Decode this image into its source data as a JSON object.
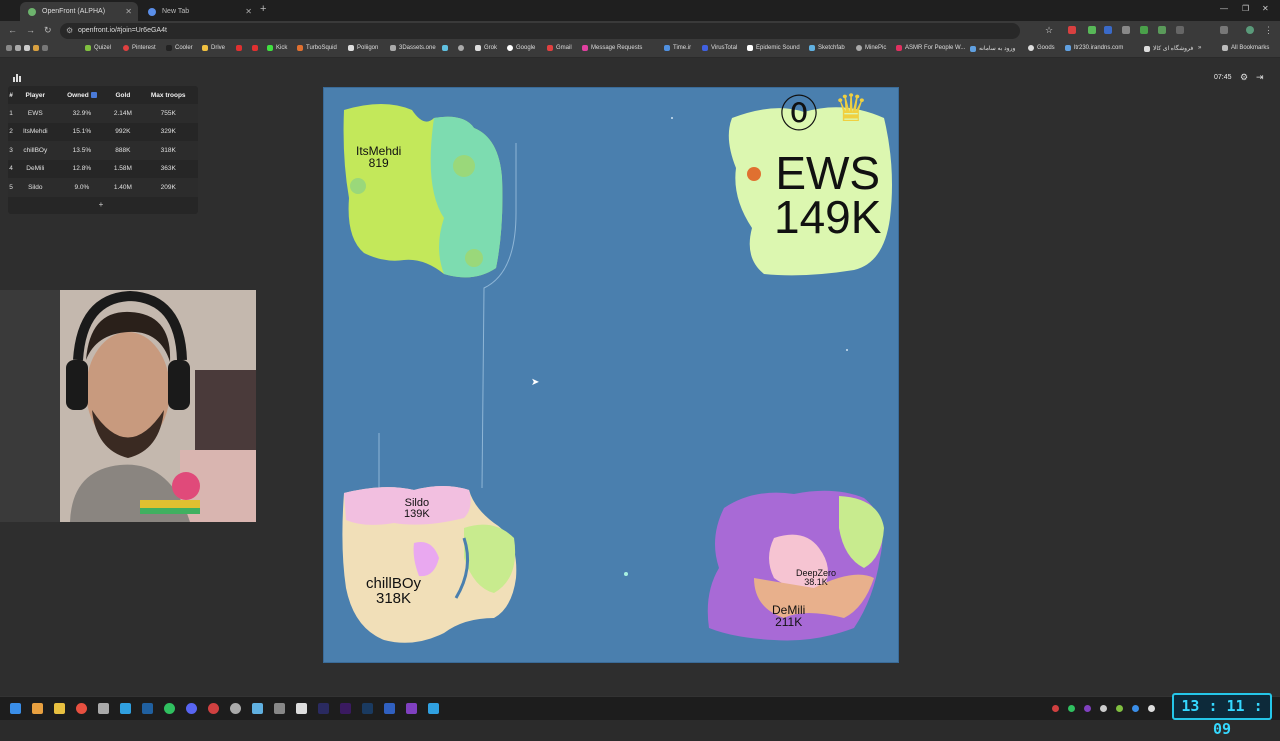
{
  "browser": {
    "tabs": [
      {
        "title": "OpenFront (ALPHA)",
        "active": true
      },
      {
        "title": "New Tab",
        "active": false
      }
    ],
    "url": "openfront.io/#join=Ur6eGA4t",
    "bookmarks": [
      "Quizel",
      "Pinterest",
      "Cooler",
      "Drive",
      "Kick",
      "TurboSquid",
      "Poliigon",
      "3Dassets.one",
      "Grok",
      "Google",
      "Gmail",
      "Message Requests",
      "Time.ir",
      "VirusTotal",
      "Epidemic Sound",
      "Sketchfab",
      "MinePic",
      "ASMR For People W...",
      "ورود به سامانه",
      "Goods",
      "ltr230.irandns.com",
      "فروشگاه ای کالا",
      "All Bookmarks"
    ]
  },
  "leaderboard": {
    "headers": [
      "#",
      "Player",
      "Owned",
      "Gold",
      "Max troops"
    ],
    "rows": [
      {
        "rank": "1",
        "player": "EWS",
        "owned": "32.9%",
        "gold": "2.14M",
        "troops": "755K"
      },
      {
        "rank": "2",
        "player": "ItsMehdi",
        "owned": "15.1%",
        "gold": "992K",
        "troops": "329K"
      },
      {
        "rank": "3",
        "player": "chillBOy",
        "owned": "13.5%",
        "gold": "888K",
        "troops": "318K"
      },
      {
        "rank": "4",
        "player": "DeMili",
        "owned": "12.8%",
        "gold": "1.58M",
        "troops": "363K"
      },
      {
        "rank": "5",
        "player": "Sildo",
        "owned": "9.0%",
        "gold": "1.40M",
        "troops": "209K"
      }
    ],
    "more_label": "+"
  },
  "hud": {
    "timer": "07:45"
  },
  "map_labels": {
    "itsmehdi": {
      "name": "ItsMehdi",
      "troops": "819"
    },
    "ews": {
      "name": "EWS",
      "troops": "149K"
    },
    "sildo": {
      "name": "Sildo",
      "troops": "139K"
    },
    "chillboy": {
      "name": "chillBOy",
      "troops": "318K"
    },
    "deepzero": {
      "name": "DeepZero",
      "troops": "38.1K"
    },
    "demili": {
      "name": "DeMili",
      "troops": "211K"
    }
  },
  "taskbar": {
    "clock": "13 : 11 : 09"
  },
  "colors": {
    "ocean": "#4a7fae",
    "ews": "#dcf7b0",
    "itsmehdi": "#c3e85a",
    "chillboy": "#f1dfb8",
    "demili": "#a86ad6",
    "clock": "#35d8ff"
  }
}
